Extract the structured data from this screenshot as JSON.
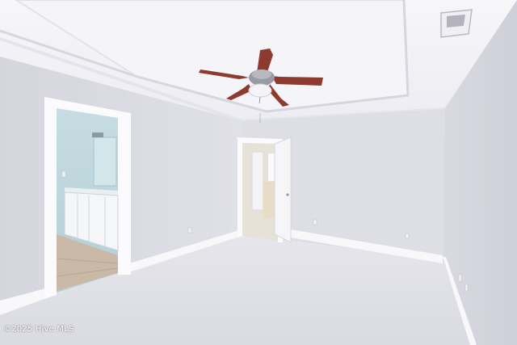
{
  "photo": {
    "subject": "empty-bedroom",
    "colors": {
      "ceiling": "#f3f3f7",
      "wall": "#dcdce3",
      "right_wall": "#d4d4dd",
      "carpet": "#e1e1e7",
      "trim": "#ffffff",
      "bath_wall": "#bcd6dc",
      "fan_blade": "#8c3b2e"
    }
  },
  "watermark": {
    "text": "©2025 Hive MLS"
  }
}
